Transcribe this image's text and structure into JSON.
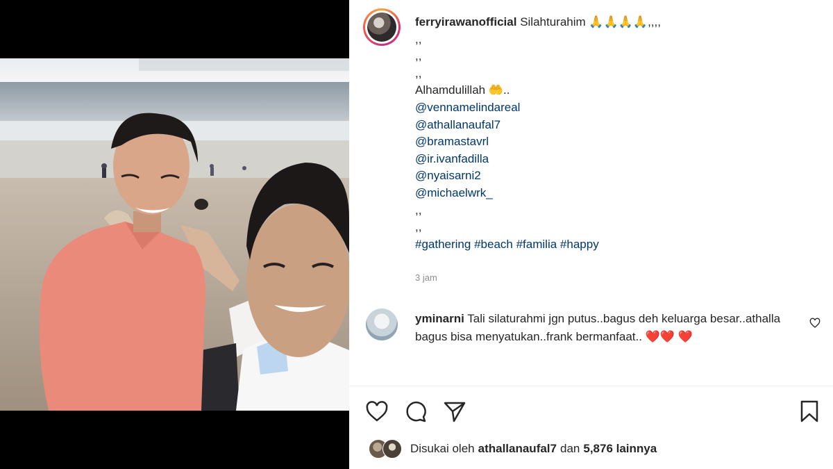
{
  "post": {
    "username": "ferryirawanofficial",
    "caption_first": "Silahturahim 🙏🙏🙏🙏,,,,",
    "caption_dots": [
      ",,",
      ",,",
      ",,"
    ],
    "alhamdulillah": "Alhamdulillah 🤲..",
    "mentions": [
      "@vennamelindareal",
      "@athallanaufal7",
      "@bramastavrl",
      "@ir.ivanfadilla",
      "@nyaisarni2",
      "@michaelwrk_"
    ],
    "caption_dots_2": [
      ",,",
      ",,"
    ],
    "hashtags": [
      "#gathering",
      "#beach",
      "#familia",
      "#happy"
    ],
    "timestamp": "3 jam"
  },
  "comment": {
    "username": "yminarni",
    "text": "Tali silaturahmi jgn putus..bagus deh keluarga besar..athalla bagus bisa menyatukan..frank bermanfaat..",
    "emoji": "❤️❤️ ❤️"
  },
  "likes": {
    "prefix": "Disukai oleh",
    "liker": "athallanaufal7",
    "connector": "dan",
    "count": "5,876 lainnya"
  },
  "icons": {
    "like": "heart-icon",
    "comment": "comment-icon",
    "share": "share-icon",
    "save": "bookmark-icon"
  }
}
